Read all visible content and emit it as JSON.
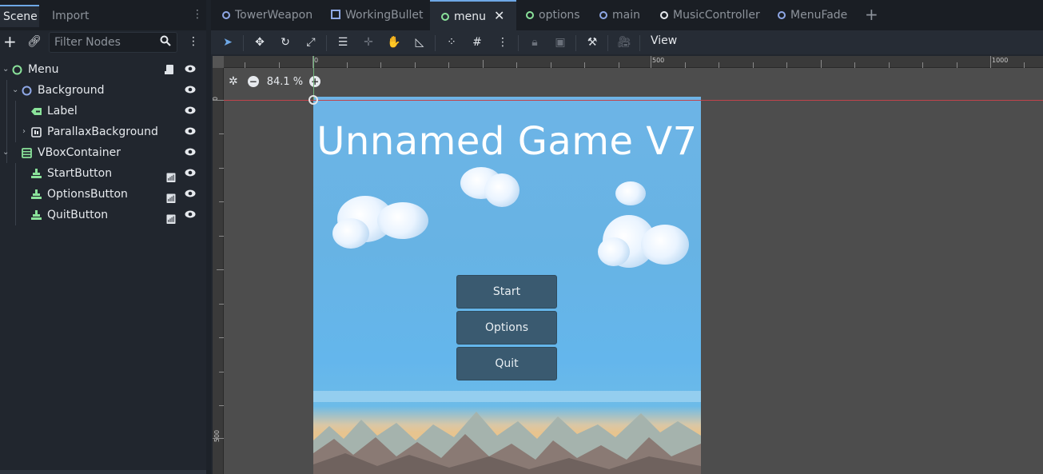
{
  "dock": {
    "tabs": [
      "Scene",
      "Import"
    ],
    "filter_placeholder": "Filter Nodes",
    "tree": [
      {
        "name": "Menu",
        "icon": "node2d-icon",
        "color": "#8ae29a"
      },
      {
        "name": "Background",
        "icon": "node-icon",
        "color": "#8fa8e6"
      },
      {
        "name": "Label",
        "icon": "label-icon",
        "color": "#8ae29a"
      },
      {
        "name": "ParallaxBackground",
        "icon": "parallax-icon",
        "color": "#e6e9ed"
      },
      {
        "name": "VBoxContainer",
        "icon": "vbox-icon",
        "color": "#8ae29a"
      },
      {
        "name": "StartButton",
        "icon": "button-icon",
        "color": "#8ae29a"
      },
      {
        "name": "OptionsButton",
        "icon": "button-icon",
        "color": "#8ae29a"
      },
      {
        "name": "QuitButton",
        "icon": "button-icon",
        "color": "#8ae29a"
      }
    ]
  },
  "editor": {
    "tabs": [
      "TowerWeapon",
      "WorkingBullet",
      "menu",
      "options",
      "main",
      "MusicController",
      "MenuFade"
    ],
    "active_tab": "menu",
    "view_label": "View",
    "zoom": "84.1 %",
    "ruler_top": [
      "0",
      "500",
      "1000"
    ],
    "ruler_left": [
      "0",
      "500"
    ]
  },
  "game": {
    "title": "Unnamed Game V7",
    "buttons": [
      "Start",
      "Options",
      "Quit"
    ]
  },
  "colors": {
    "accent": "#6ea8e6",
    "node_green": "#8ae29a",
    "button_bg": "#3a5a70"
  }
}
